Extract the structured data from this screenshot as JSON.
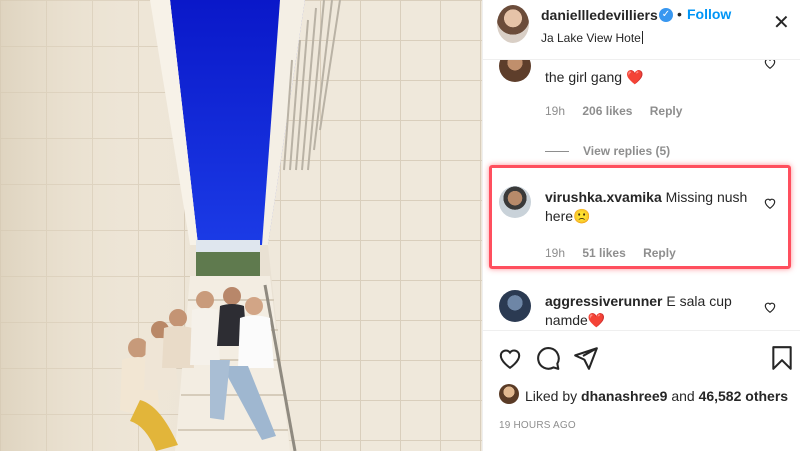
{
  "post": {
    "author": "daniellledevilliers",
    "follow_label": "Follow",
    "dot": "•",
    "location": "Ja Lake View Hote",
    "verified_icon": "verified-badge-icon",
    "close_icon": "close-icon",
    "photo_alt": "group-of-women-on-stairs-photo"
  },
  "comments": [
    {
      "username": "",
      "text": "the girl gang ❤️",
      "time": "19h",
      "likes": "206 likes",
      "reply": "Reply"
    },
    {
      "view_replies": "View replies (5)"
    },
    {
      "username": "virushka.xvamika",
      "text": "Missing nush here🙁",
      "time": "19h",
      "likes": "51 likes",
      "reply": "Reply"
    },
    {
      "username": "aggressiverunner",
      "text": "E sala cup namde❤️"
    }
  ],
  "actions": {
    "icons": [
      "heart-icon",
      "comment-icon",
      "share-icon",
      "bookmark-icon"
    ],
    "liked_prefix": "Liked by",
    "liked_user": "dhanashree9",
    "liked_and": "and",
    "liked_others": "46,582 others",
    "timestamp": "19 HOURS AGO"
  },
  "colors": {
    "accent": "#0095f6",
    "highlight": "#ff4f5e",
    "muted": "#8e8e8e",
    "text": "#262626",
    "sky": "#0b1fd6"
  }
}
